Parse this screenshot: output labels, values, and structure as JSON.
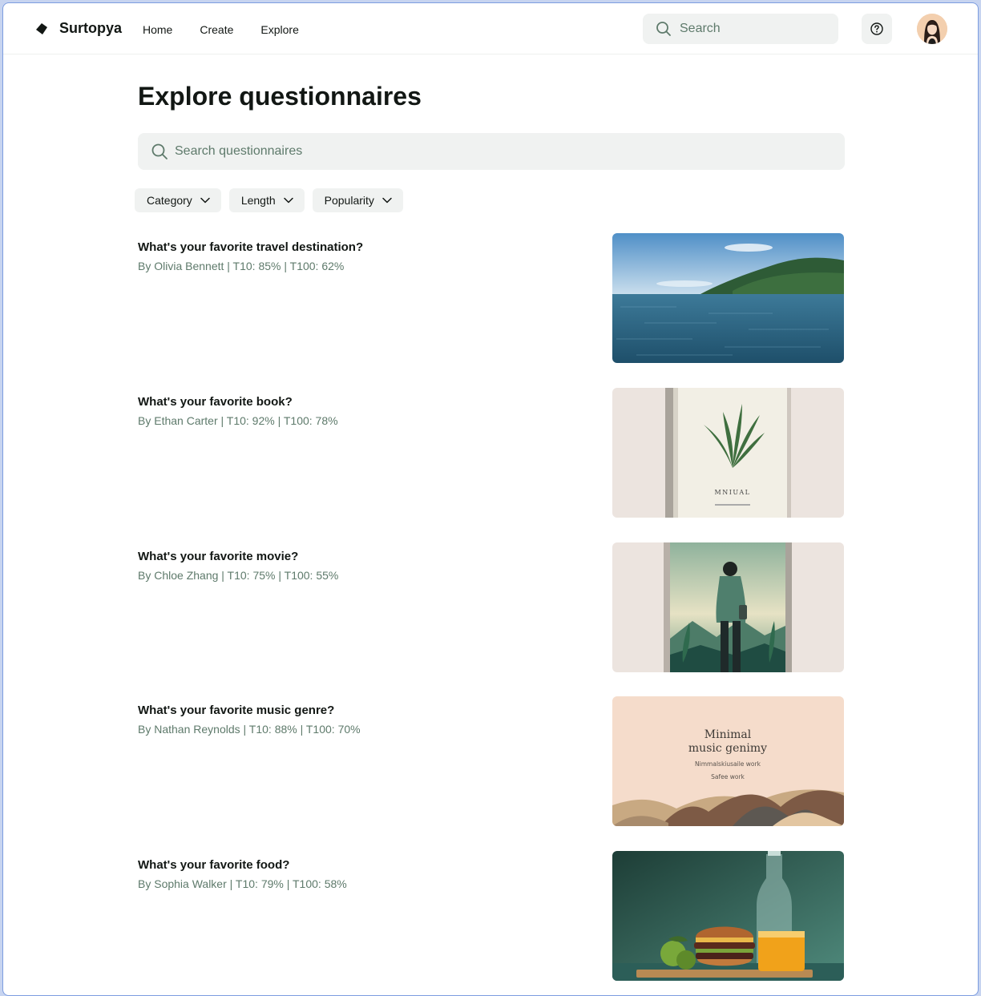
{
  "header": {
    "brand": "Surtopya",
    "nav": [
      "Home",
      "Create",
      "Explore"
    ],
    "search_placeholder": "Search"
  },
  "main": {
    "title": "Explore questionnaires",
    "search_placeholder": "Search questionnaires",
    "filters": [
      "Category",
      "Length",
      "Popularity"
    ],
    "cards": [
      {
        "title": "What's your favorite travel destination?",
        "meta": "By Olivia Bennett | T10: 85% | T100: 62%"
      },
      {
        "title": "What's your favorite book?",
        "meta": "By Ethan Carter | T10: 92% | T100: 78%"
      },
      {
        "title": "What's your favorite movie?",
        "meta": "By Chloe Zhang | T10: 75% | T100: 55%"
      },
      {
        "title": "What's your favorite music genre?",
        "meta": "By Nathan Reynolds | T10: 88% | T100: 70%"
      },
      {
        "title": "What's your favorite food?",
        "meta": "By Sophia Walker | T10: 79% | T100: 58%"
      }
    ],
    "thumb_text": {
      "book_label": "MNIUAL",
      "music_line1": "Minimal",
      "music_line2": "music genimy",
      "music_line3": "Nimmalskiusaile work",
      "music_line4": "Safee work"
    }
  },
  "colors": {
    "accent_text": "#5e7a6b",
    "chip_bg": "#f0f2f1",
    "frame_border": "#7d9de0"
  }
}
